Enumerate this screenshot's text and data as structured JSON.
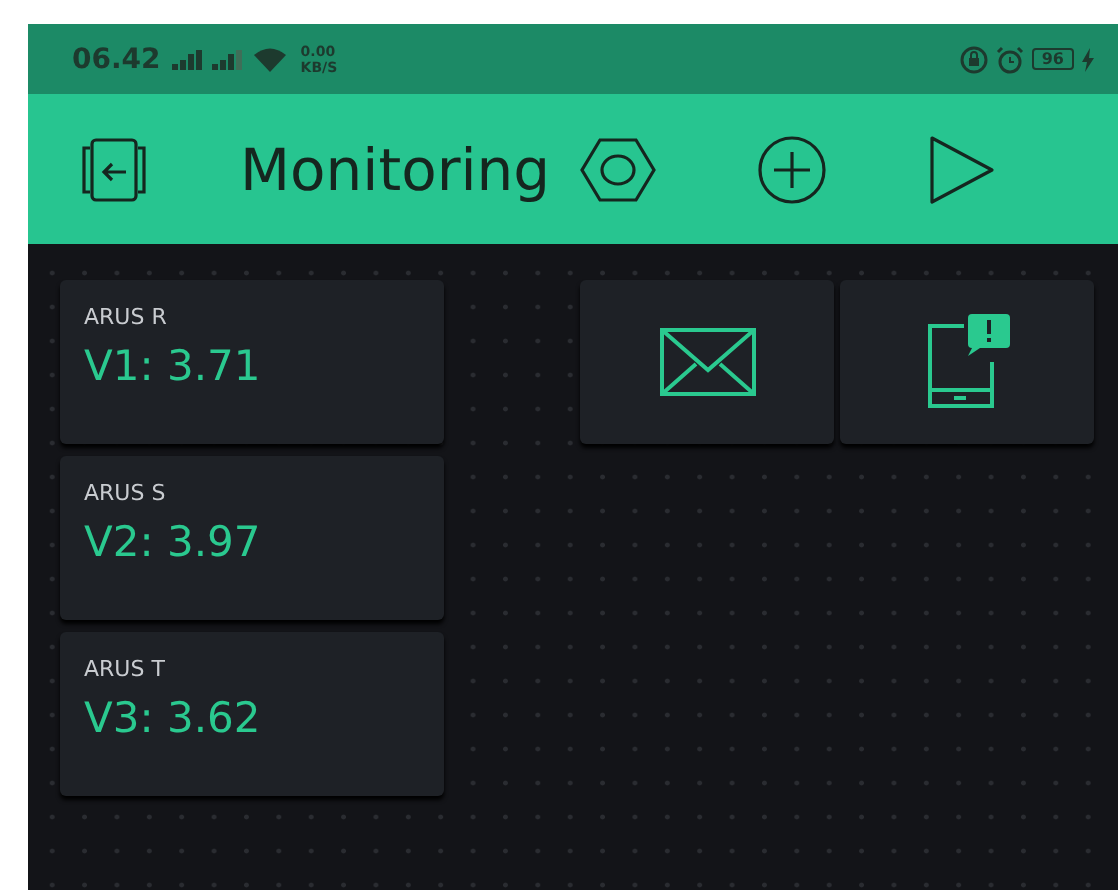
{
  "status_bar": {
    "time": "06.42",
    "speed": "0.00",
    "speed_unit": "KB/S",
    "battery": "96"
  },
  "app_bar": {
    "title": "Monitoring"
  },
  "widgets": [
    {
      "kind": "display",
      "label": "ARUS R",
      "value": "V1: 3.71"
    },
    {
      "kind": "email"
    },
    {
      "kind": "notification"
    },
    {
      "kind": "display",
      "label": "ARUS S",
      "value": "V2: 3.97"
    },
    {
      "kind": "display",
      "label": "ARUS T",
      "value": "V3: 3.62"
    }
  ]
}
